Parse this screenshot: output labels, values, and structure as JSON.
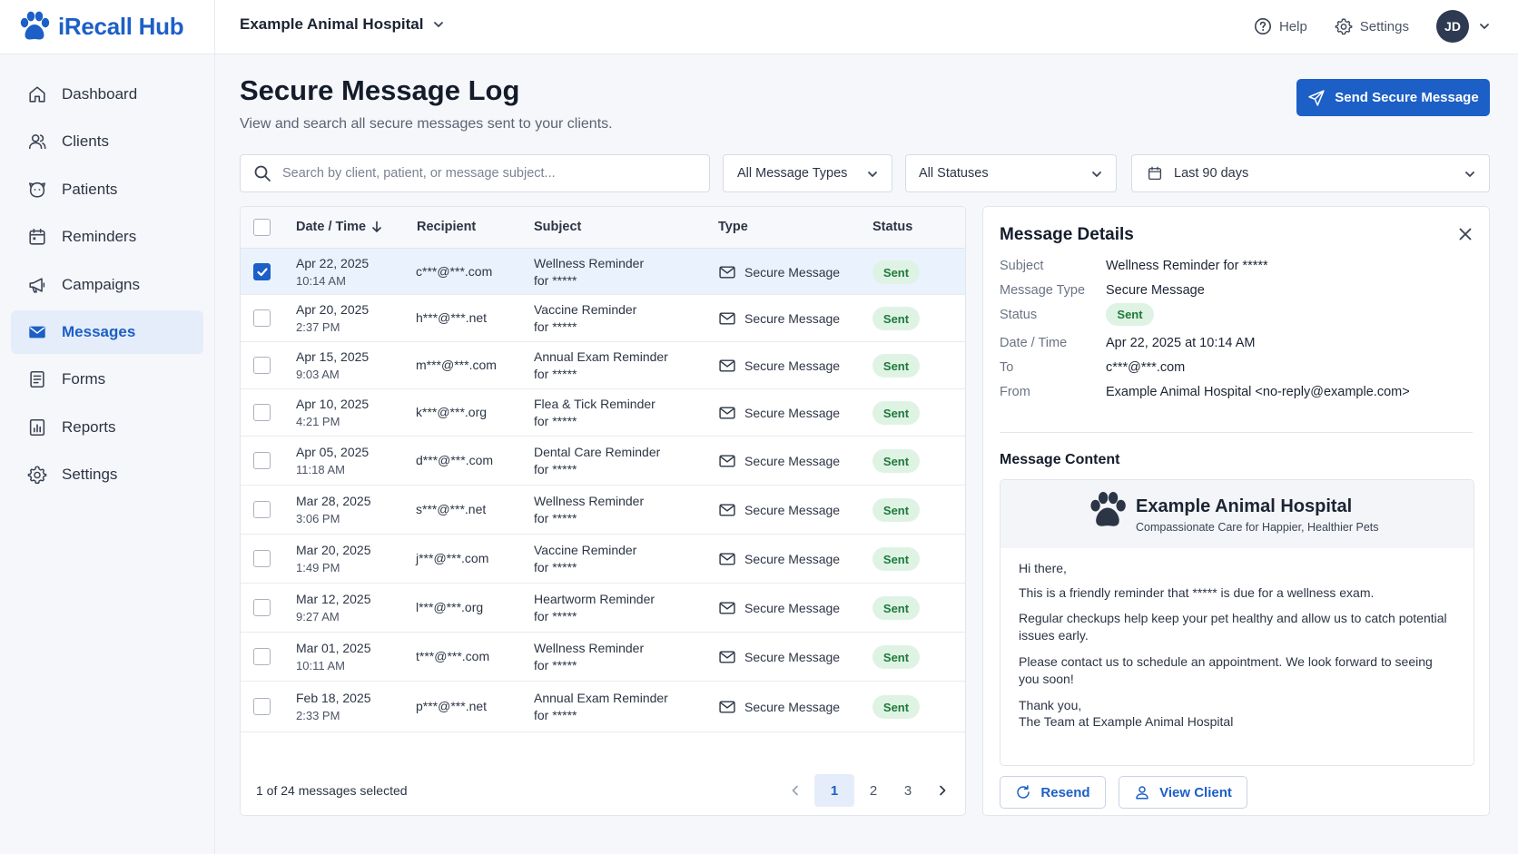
{
  "app": {
    "name": "iRecall Hub"
  },
  "colors": {
    "accent": "#1c5fc7",
    "sent_bg": "#dff3e4",
    "sent_fg": "#1e7a3b"
  },
  "header": {
    "hospital": "Example Animal Hospital",
    "help_label": "Help",
    "settings_label": "Settings",
    "user_initials": "JD"
  },
  "sidebar": {
    "items": [
      {
        "label": "Dashboard",
        "icon": "home-icon"
      },
      {
        "label": "Clients",
        "icon": "users-icon"
      },
      {
        "label": "Patients",
        "icon": "paw-icon"
      },
      {
        "label": "Reminders",
        "icon": "calendar-icon"
      },
      {
        "label": "Campaigns",
        "icon": "megaphone-icon"
      },
      {
        "label": "Messages",
        "icon": "envelope-icon",
        "active": true
      },
      {
        "label": "Forms",
        "icon": "document-icon"
      },
      {
        "label": "Reports",
        "icon": "chart-icon"
      },
      {
        "label": "Settings",
        "icon": "gear-icon"
      }
    ]
  },
  "page": {
    "title": "Secure Message Log",
    "subtitle": "View and search all secure messages sent to your clients.",
    "send_button": "Send Secure Message"
  },
  "filters": {
    "search_placeholder": "Search by client, patient, or message subject...",
    "type": "All Message Types",
    "status": "All Statuses",
    "date_range": "Last 90 days"
  },
  "table": {
    "columns": {
      "date": "Date / Time",
      "recipient": "Recipient",
      "subject": "Subject",
      "type": "Type",
      "status": "Status"
    },
    "rows": [
      {
        "date": "Apr 22, 2025",
        "time": "10:14 AM",
        "recipient": "c***@***.com",
        "subject": "Wellness Reminder",
        "subject_for": "for *****",
        "type": "Secure Message",
        "status": "Sent",
        "selected": true
      },
      {
        "date": "Apr 20, 2025",
        "time": "2:37 PM",
        "recipient": "h***@***.net",
        "subject": "Vaccine Reminder",
        "subject_for": "for *****",
        "type": "Secure Message",
        "status": "Sent"
      },
      {
        "date": "Apr 15, 2025",
        "time": "9:03 AM",
        "recipient": "m***@***.com",
        "subject": "Annual Exam Reminder",
        "subject_for": "for *****",
        "type": "Secure Message",
        "status": "Sent"
      },
      {
        "date": "Apr 10, 2025",
        "time": "4:21 PM",
        "recipient": "k***@***.org",
        "subject": "Flea & Tick Reminder",
        "subject_for": "for *****",
        "type": "Secure Message",
        "status": "Sent"
      },
      {
        "date": "Apr 05, 2025",
        "time": "11:18 AM",
        "recipient": "d***@***.com",
        "subject": "Dental Care Reminder",
        "subject_for": "for *****",
        "type": "Secure Message",
        "status": "Sent"
      },
      {
        "date": "Mar 28, 2025",
        "time": "3:06 PM",
        "recipient": "s***@***.net",
        "subject": "Wellness Reminder",
        "subject_for": "for *****",
        "type": "Secure Message",
        "status": "Sent"
      },
      {
        "date": "Mar 20, 2025",
        "time": "1:49 PM",
        "recipient": "j***@***.com",
        "subject": "Vaccine Reminder",
        "subject_for": "for *****",
        "type": "Secure Message",
        "status": "Sent"
      },
      {
        "date": "Mar 12, 2025",
        "time": "9:27 AM",
        "recipient": "l***@***.org",
        "subject": "Heartworm Reminder",
        "subject_for": "for *****",
        "type": "Secure Message",
        "status": "Sent"
      },
      {
        "date": "Mar 01, 2025",
        "time": "10:11 AM",
        "recipient": "t***@***.com",
        "subject": "Wellness Reminder",
        "subject_for": "for *****",
        "type": "Secure Message",
        "status": "Sent"
      },
      {
        "date": "Feb 18, 2025",
        "time": "2:33 PM",
        "recipient": "p***@***.net",
        "subject": "Annual Exam Reminder",
        "subject_for": "for *****",
        "type": "Secure Message",
        "status": "Sent"
      }
    ],
    "selection_text": "1 of 24 messages selected",
    "pages": [
      "1",
      "2",
      "3"
    ],
    "current_page": "1"
  },
  "details": {
    "title": "Message Details",
    "fields": [
      {
        "label": "Subject",
        "value": "Wellness Reminder for *****"
      },
      {
        "label": "Message Type",
        "value": "Secure Message"
      },
      {
        "label": "Status",
        "value": "Sent"
      },
      {
        "label": "Date / Time",
        "value": "Apr 22, 2025 at 10:14 AM"
      },
      {
        "label": "To",
        "value": "c***@***.com"
      },
      {
        "label": "From",
        "value": "Example Animal Hospital <no-reply@example.com>"
      }
    ],
    "content_title": "Message Content",
    "email": {
      "hospital": "Example Animal Hospital",
      "tagline": "Compassionate Care for Happier, Healthier Pets",
      "greeting": "Hi there,",
      "p1": "This is a friendly reminder that ***** is due for a wellness exam.",
      "p2": "Regular checkups help keep your pet healthy and allow us to catch potential issues early.",
      "p3": "Please contact us to schedule an appointment. We look forward to seeing you soon!",
      "signoff": "Thank you,",
      "signature": "The Team at Example Animal Hospital"
    },
    "resend_button": "Resend",
    "view_client_button": "View Client"
  }
}
